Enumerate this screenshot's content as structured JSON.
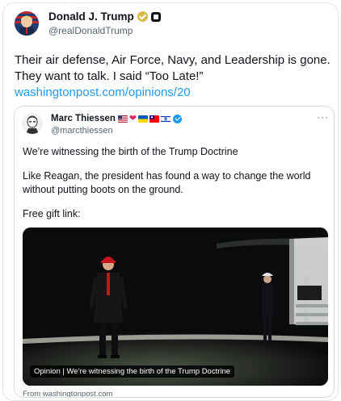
{
  "author": {
    "name": "Donald J. Trump",
    "handle": "@realDonaldTrump"
  },
  "tweet": {
    "text": "Their air defense, Air Force, Navy, and Leadership is gone. They want to talk. I said “Too Late!”",
    "link": "washingtonpost.com/opinions/20"
  },
  "quoted": {
    "name": "Marc Thiessen",
    "handle": "@marcthiessen",
    "more_label": "···",
    "paragraphs": [
      "We’re witnessing the birth of the Trump Doctrine",
      "Like Reagan, the president has found a way to change the world without putting boots on the ground.",
      "Free gift link:"
    ],
    "media": {
      "caption": "Opinion | We’re witnessing the birth of the Trump Doctrine"
    },
    "source": "From washingtonpost.com"
  },
  "icons": {
    "badges": [
      "gold-verified-icon",
      "affiliate-badge-icon",
      "blue-verified-icon",
      "more-icon"
    ],
    "flags": [
      "us-flag-icon",
      "heart-icon",
      "ukraine-flag-icon",
      "taiwan-flag-icon",
      "israel-flag-icon"
    ]
  },
  "colors": {
    "link": "#1d9bf0",
    "secondary_text": "#536471",
    "border": "#d7dce0"
  }
}
